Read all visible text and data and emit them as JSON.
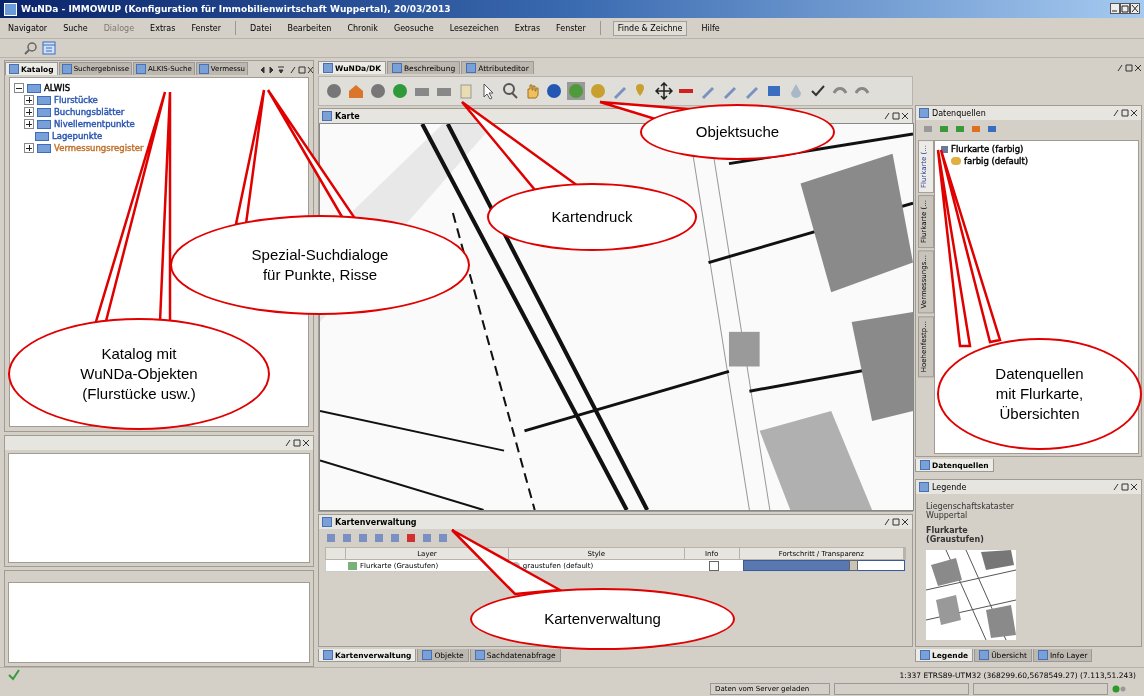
{
  "window": {
    "title": "WuNDa - IMMOWUP (Konfiguration für Immobilienwirtschaft Wuppertal), 20/03/2013"
  },
  "menu": [
    {
      "label": "Navigator",
      "disabled": false,
      "selected": false
    },
    {
      "label": "Suche",
      "disabled": false,
      "selected": false
    },
    {
      "label": "Dialoge",
      "disabled": true,
      "selected": false
    },
    {
      "label": "Extras",
      "disabled": false,
      "selected": false
    },
    {
      "label": "Fenster",
      "disabled": false,
      "selected": false
    },
    {
      "label": "Datei",
      "disabled": false,
      "selected": false
    },
    {
      "label": "Bearbeiten",
      "disabled": false,
      "selected": false
    },
    {
      "label": "Chronik",
      "disabled": false,
      "selected": false
    },
    {
      "label": "Geosuche",
      "disabled": false,
      "selected": false
    },
    {
      "label": "Lesezeichen",
      "disabled": false,
      "selected": false
    },
    {
      "label": "Extras",
      "disabled": false,
      "selected": false
    },
    {
      "label": "Fenster",
      "disabled": false,
      "selected": false
    },
    {
      "label": "Finde & Zeichne",
      "disabled": false,
      "selected": true
    },
    {
      "label": "Hilfe",
      "disabled": false,
      "selected": false
    }
  ],
  "left_panel": {
    "tabs": [
      {
        "label": "Katalog",
        "selected": true
      },
      {
        "label": "Suchergebnisse",
        "selected": false
      },
      {
        "label": "ALKIS-Suche",
        "selected": false
      },
      {
        "label": "Vermessu",
        "selected": false
      }
    ],
    "tree": {
      "label": "ALWIS",
      "expanded": true,
      "children": [
        {
          "label": "Flurstücke",
          "has_children": true,
          "expanded": false,
          "color": "#2a55b0"
        },
        {
          "label": "Buchungsblätter",
          "has_children": true,
          "expanded": false,
          "color": "#2a55b0"
        },
        {
          "label": "Nivellementpunkte",
          "has_children": true,
          "expanded": false,
          "color": "#2a55b0"
        },
        {
          "label": "Lagepunkte",
          "has_children": false,
          "expanded": false,
          "color": "#2a55b0"
        },
        {
          "label": "Vermessungsregister",
          "has_children": true,
          "expanded": false,
          "color": "#c0702a"
        }
      ]
    }
  },
  "center": {
    "tabs": [
      {
        "label": "WuNDa/DK",
        "selected": true
      },
      {
        "label": "Beschreibung",
        "selected": false
      },
      {
        "label": "Attributeditor",
        "selected": false
      }
    ],
    "map_panel": {
      "title": "Karte"
    },
    "layer_panel": {
      "title": "Kartenverwaltung",
      "columns": [
        "Layer",
        "Style",
        "Info",
        "Fortschritt / Transparenz"
      ],
      "rows": [
        {
          "layer": "Flurkarte (Graustufen)",
          "style": "graustufen (default)",
          "info": false,
          "level": 0.68
        }
      ]
    },
    "bottom_tabs": [
      {
        "label": "Kartenverwaltung",
        "selected": true
      },
      {
        "label": "Objekte",
        "selected": false
      },
      {
        "label": "Sachdatenabfrage",
        "selected": false
      }
    ]
  },
  "right": {
    "sources_panel": {
      "title": "Datenquellen",
      "side_tabs": [
        {
          "label": "Flurkarte (...",
          "selected": true
        },
        {
          "label": "Flurkarte (...",
          "selected": false
        },
        {
          "label": "Vermessungs...",
          "selected": false
        },
        {
          "label": "Hoehenfestp...",
          "selected": false
        }
      ],
      "tree": {
        "label": "Flurkarte (farbig)",
        "children": [
          {
            "label": "farbig (default)"
          }
        ]
      }
    },
    "middle_tabs": [
      {
        "label": "Datenquellen",
        "selected": true
      }
    ],
    "legend_panel": {
      "title": "Legende",
      "source": "Liegenschaftskataster Wuppertal",
      "layer": "Flurkarte (Graustufen)"
    },
    "bottom_tabs": [
      {
        "label": "Legende",
        "selected": true
      },
      {
        "label": "Übersicht",
        "selected": false
      },
      {
        "label": "Info Layer",
        "selected": false
      }
    ]
  },
  "status_bar": {
    "coordinates": "1:337 ETRS89-UTM32 (368299.60,5678549.27) (7.113,51.243)",
    "message": "Daten vom Server geladen"
  },
  "callouts": [
    {
      "lines": [
        "Objektsuche"
      ]
    },
    {
      "lines": [
        "Kartendruck"
      ]
    },
    {
      "lines": [
        "Spezial-Suchdialoge",
        "für Punkte, Risse"
      ]
    },
    {
      "lines": [
        "Katalog mit",
        "WuNDa-Objekten",
        "(Flurstücke usw.)"
      ]
    },
    {
      "lines": [
        "Datenquellen",
        "mit Flurkarte,",
        "Übersichten"
      ]
    },
    {
      "lines": [
        "Kartenverwaltung"
      ]
    }
  ]
}
